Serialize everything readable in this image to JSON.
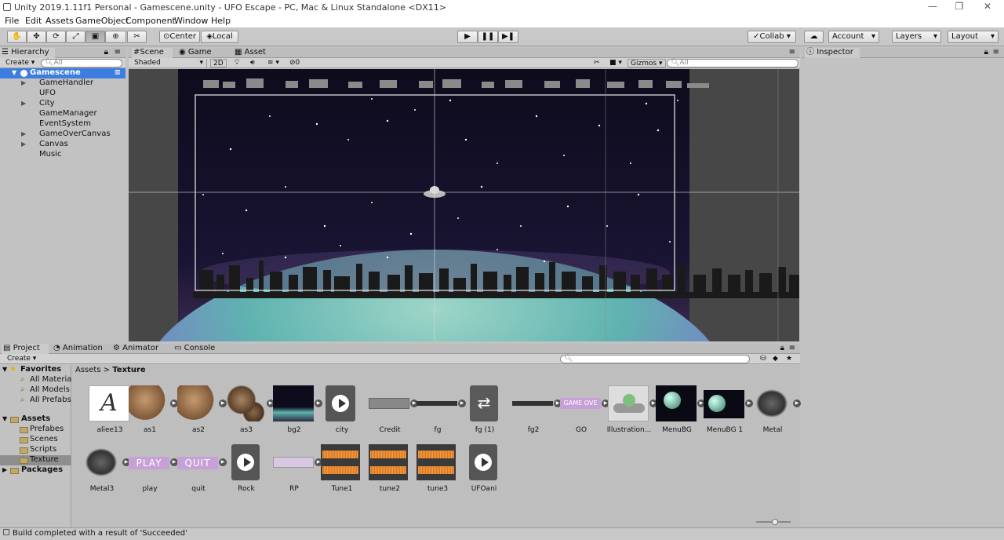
{
  "window": {
    "title": "Unity 2019.1.11f1 Personal - Gamescene.unity - UFO Escape - PC, Mac & Linux Standalone <DX11>",
    "minimize": "—",
    "maximize": "❐",
    "close": "✕"
  },
  "menu": [
    "File",
    "Edit",
    "Assets",
    "GameObject",
    "Component",
    "Window",
    "Help"
  ],
  "toolbar": {
    "tools": [
      "hand-tool",
      "move-tool",
      "rotate-tool",
      "scale-tool",
      "rect-tool",
      "transform-tool",
      "custom-tool"
    ],
    "pivot": "Center",
    "space": "Local",
    "play": "▶",
    "pause": "❚❚",
    "step": "▶❚",
    "collab": "Collab",
    "account": "Account",
    "layers": "Layers",
    "layout": "Layout"
  },
  "hierarchy": {
    "tab": "Hierarchy",
    "create": "Create",
    "search_placeholder": "All",
    "scene": "Gamescene",
    "items": [
      {
        "label": "GameHandler",
        "expandable": true
      },
      {
        "label": "UFO",
        "expandable": false
      },
      {
        "label": "City",
        "expandable": true
      },
      {
        "label": "GameManager",
        "expandable": false
      },
      {
        "label": "EventSystem",
        "expandable": false
      },
      {
        "label": "GameOverCanvas",
        "expandable": true
      },
      {
        "label": "Canvas",
        "expandable": true
      },
      {
        "label": "Music",
        "expandable": false
      }
    ]
  },
  "scene": {
    "tabs": [
      "Scene",
      "Game",
      "Asset Store"
    ],
    "shading": "Shaded",
    "mode2d": "2D",
    "effects_count": "0",
    "gizmos": "Gizmos",
    "search_placeholder": "All"
  },
  "inspector": {
    "tab": "Inspector"
  },
  "project": {
    "tabs": [
      "Project",
      "Animation",
      "Animator",
      "Console"
    ],
    "create": "Create",
    "breadcrumb_root": "Assets",
    "breadcrumb_sep": ">",
    "breadcrumb_current": "Texture",
    "favorites_label": "Favorites",
    "favorites": [
      "All Materials",
      "All Models",
      "All Prefabs"
    ],
    "assets_label": "Assets",
    "asset_folders": [
      "Prefabes",
      "Scenes",
      "Scripts",
      "Texture"
    ],
    "packages_label": "Packages",
    "assets_row1": [
      "aliee13",
      "as1",
      "as2",
      "as3",
      "bg2",
      "city",
      "Credit",
      "fg",
      "fg (1)",
      "fg2",
      "GO",
      "Illustration...",
      "MenuBG",
      "MenuBG 1",
      "Metal"
    ],
    "assets_row2": [
      "Metal3",
      "play",
      "quit",
      "Rock",
      "RP",
      "Tune1",
      "tune2",
      "tune3",
      "UFOani"
    ],
    "sprite_texts": {
      "play": "PLAY",
      "quit": "QUIT",
      "go": "GAME OVE",
      "font_letter": "A"
    }
  },
  "status": "Build completed with a result of 'Succeeded'",
  "colors": {
    "selection": "#3e7de0",
    "sky": "#120f22",
    "planet": "#5fb3b0",
    "editor_bg": "#c2c2c2"
  }
}
